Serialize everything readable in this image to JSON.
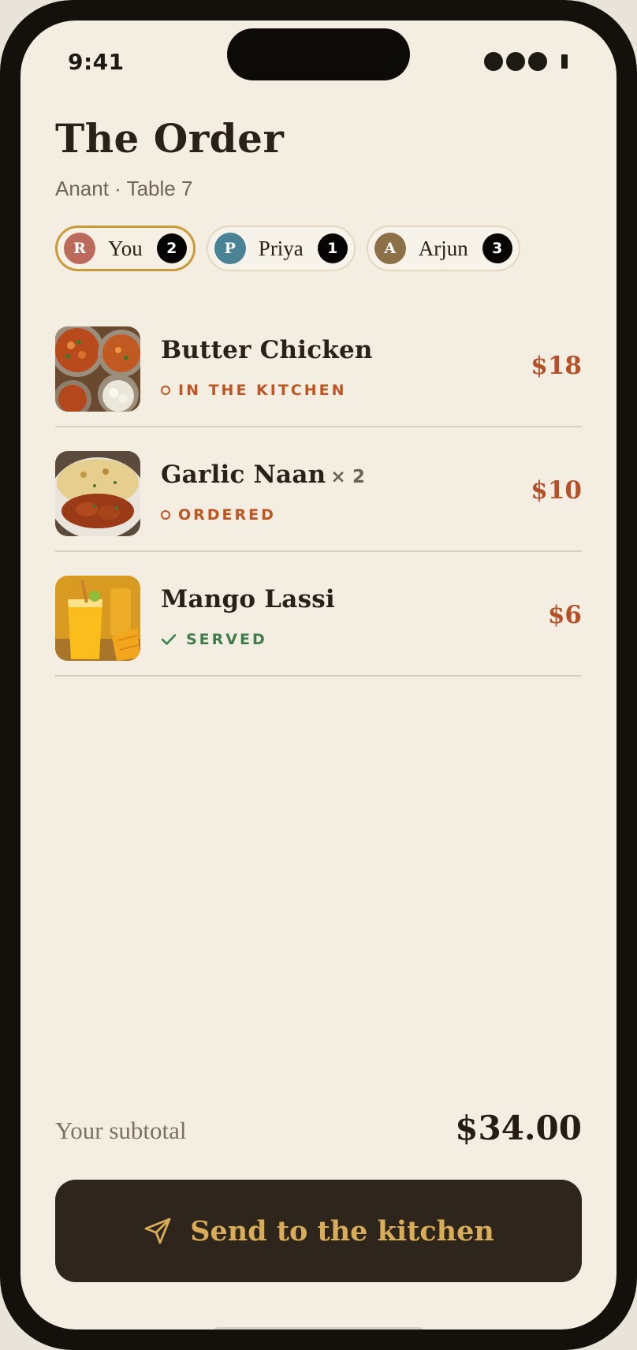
{
  "status_bar": {
    "time": "9:41"
  },
  "page": {
    "title": "The Order",
    "subtitle": "Anant · Table 7"
  },
  "diners": [
    {
      "initial": "R",
      "name": "You",
      "count": "2",
      "color": "#bc6a5c",
      "active": true
    },
    {
      "initial": "P",
      "name": "Priya",
      "count": "1",
      "color": "#4a8296",
      "active": false
    },
    {
      "initial": "A",
      "name": "Arjun",
      "count": "3",
      "color": "#8c7048",
      "active": false
    }
  ],
  "items": [
    {
      "name": "Butter Chicken",
      "qty": "",
      "status": "IN THE KITCHEN",
      "status_type": "kitchen",
      "price": "$18",
      "image_icon": "butter-chicken-photo"
    },
    {
      "name": "Garlic Naan",
      "qty": "× 2",
      "status": "ORDERED",
      "status_type": "ordered",
      "price": "$10",
      "image_icon": "garlic-naan-photo"
    },
    {
      "name": "Mango Lassi",
      "qty": "",
      "status": "SERVED",
      "status_type": "served",
      "price": "$6",
      "image_icon": "mango-lassi-photo"
    }
  ],
  "summary": {
    "subtotal_label": "Your subtotal",
    "subtotal_value": "$34.00"
  },
  "send_button": {
    "label": "Send to the kitchen",
    "icon": "send-icon"
  },
  "colors": {
    "accent": "#b4502a",
    "kitchen": "#c05524",
    "served": "#3c7d48",
    "button_bg": "#2e261c",
    "button_text": "#d9ac58"
  }
}
